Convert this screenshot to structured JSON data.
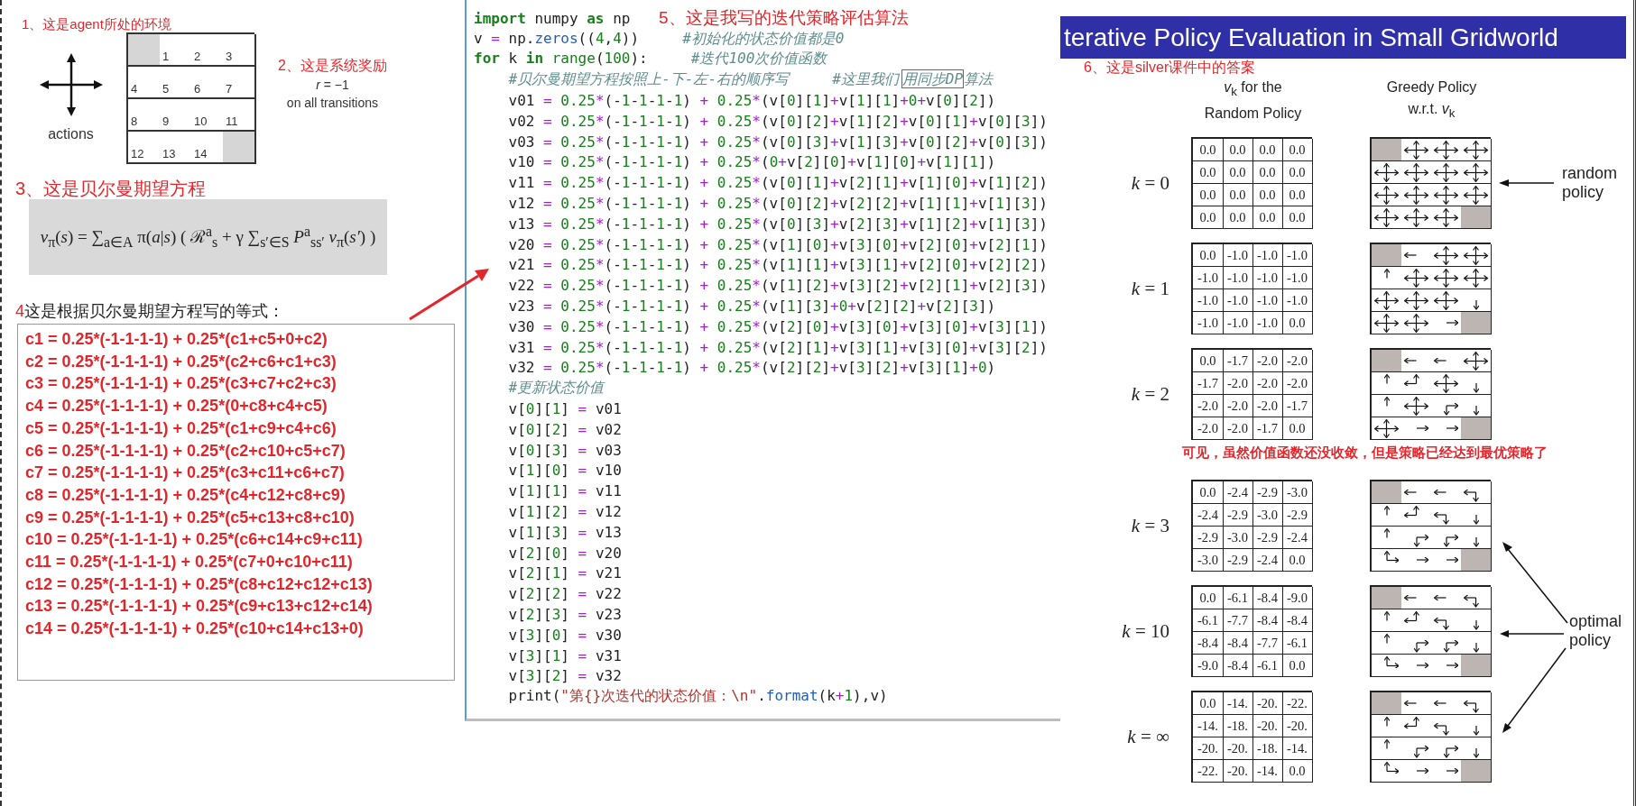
{
  "left": {
    "environment": {
      "caption": "1、这是agent所处的环境",
      "actions_label": "actions",
      "cells": [
        {
          "terminal": true
        },
        {
          "terminal": false,
          "label": "1"
        },
        {
          "terminal": false,
          "label": "2"
        },
        {
          "terminal": false,
          "label": "3"
        },
        {
          "terminal": false,
          "label": "4"
        },
        {
          "terminal": false,
          "label": "5"
        },
        {
          "terminal": false,
          "label": "6"
        },
        {
          "terminal": false,
          "label": "7"
        },
        {
          "terminal": false,
          "label": "8"
        },
        {
          "terminal": false,
          "label": "9"
        },
        {
          "terminal": false,
          "label": "10"
        },
        {
          "terminal": false,
          "label": "11"
        },
        {
          "terminal": false,
          "label": "12"
        },
        {
          "terminal": false,
          "label": "13"
        },
        {
          "terminal": false,
          "label": "14"
        },
        {
          "terminal": true
        }
      ]
    },
    "reward": {
      "caption": "2、这是系统奖励",
      "formula": "*r* = −1",
      "note": "on all transitions"
    },
    "bellman": {
      "caption": "3、这是贝尔曼期望方程",
      "formula": "*v*$_{π}$(*s*) = ∑$_{a∈A}$ π(*a*|*s*) ( ℛ$^{a}$$_{s}$ + γ ∑$_{s′∈S}$ *P*$^{a}$$_{ss′}$ *v*$_{π}$(*s′*) )"
    },
    "equations": {
      "number": "4",
      "caption": "这是根据贝尔曼期望方程写的等式：",
      "lines": [
        "c1 = 0.25*(-1-1-1-1) + 0.25*(c1+c5+0+c2)",
        "c2 = 0.25*(-1-1-1-1) + 0.25*(c2+c6+c1+c3)",
        "c3 = 0.25*(-1-1-1-1) + 0.25*(c3+c7+c2+c3)",
        "c4 = 0.25*(-1-1-1-1) + 0.25*(0+c8+c4+c5)",
        "c5 = 0.25*(-1-1-1-1) + 0.25*(c1+c9+c4+c6)",
        "c6 = 0.25*(-1-1-1-1) + 0.25*(c2+c10+c5+c7)",
        "c7 = 0.25*(-1-1-1-1) + 0.25*(c3+c11+c6+c7)",
        "c8 = 0.25*(-1-1-1-1) + 0.25*(c4+c12+c8+c9)",
        "c9 = 0.25*(-1-1-1-1) + 0.25*(c5+c13+c8+c10)",
        "c10 = 0.25*(-1-1-1-1) + 0.25*(c6+c14+c9+c11)",
        "c11 = 0.25*(-1-1-1-1) + 0.25*(c7+0+c10+c11)",
        "c12 = 0.25*(-1-1-1-1) + 0.25*(c8+c12+c12+c13)",
        "c13 = 0.25*(-1-1-1-1) + 0.25*(c9+c13+c12+c14)",
        "c14 = 0.25*(-1-1-1-1) + 0.25*(c10+c14+c13+0)"
      ]
    }
  },
  "code": {
    "lines": [
      {
        "indented": false,
        "note": "5、这是我写的迭代策略评估算法",
        "segments": [
          {
            "kind": "keyword",
            "text": "import"
          },
          {
            "kind": "code",
            "text": " numpy "
          },
          {
            "kind": "keyword",
            "text": "as"
          },
          {
            "kind": "code",
            "text": " np"
          }
        ]
      },
      {
        "indented": false,
        "segments": [
          {
            "kind": "code",
            "text": "v = np."
          },
          {
            "kind": "function",
            "text": "zeros"
          },
          {
            "kind": "code",
            "text": "((4,4))"
          },
          {
            "kind": "comment",
            "text": "#初始化的状态价值都是0"
          }
        ]
      },
      {
        "indented": false,
        "segments": [
          {
            "kind": "keyword",
            "text": "for"
          },
          {
            "kind": "code",
            "text": " k "
          },
          {
            "kind": "keyword",
            "text": "in"
          },
          {
            "kind": "builtin",
            "text": " range"
          },
          {
            "kind": "code",
            "text": "(100):"
          },
          {
            "kind": "comment",
            "text": "#迭代100次价值函数"
          }
        ]
      },
      {
        "indented": true,
        "segments": [
          {
            "kind": "comment",
            "text": "#贝尔曼期望方程按照上-下-左-右的顺序写"
          },
          {
            "kind": "comment",
            "text": "#这里我们"
          },
          {
            "kind": "comment-boxed",
            "text": "用同步DP"
          },
          {
            "kind": "comment-cont",
            "text": "算法"
          }
        ]
      },
      {
        "indented": true,
        "segments": [
          {
            "kind": "code",
            "text": "v01 = 0.25*(-1-1-1-1) + 0.25*(v[0][1]+v[1][1]+0+v[0][2])"
          }
        ]
      },
      {
        "indented": true,
        "segments": [
          {
            "kind": "code",
            "text": "v02 = 0.25*(-1-1-1-1) + 0.25*(v[0][2]+v[1][2]+v[0][1]+v[0][3])"
          }
        ]
      },
      {
        "indented": true,
        "segments": [
          {
            "kind": "code",
            "text": "v03 = 0.25*(-1-1-1-1) + 0.25*(v[0][3]+v[1][3]+v[0][2]+v[0][3])"
          }
        ]
      },
      {
        "indented": true,
        "segments": [
          {
            "kind": "code",
            "text": "v10 = 0.25*(-1-1-1-1) + 0.25*(0+v[2][0]+v[1][0]+v[1][1])"
          }
        ]
      },
      {
        "indented": true,
        "segments": [
          {
            "kind": "code",
            "text": "v11 = 0.25*(-1-1-1-1) + 0.25*(v[0][1]+v[2][1]+v[1][0]+v[1][2])"
          }
        ]
      },
      {
        "indented": true,
        "segments": [
          {
            "kind": "code",
            "text": "v12 = 0.25*(-1-1-1-1) + 0.25*(v[0][2]+v[2][2]+v[1][1]+v[1][3])"
          }
        ]
      },
      {
        "indented": true,
        "segments": [
          {
            "kind": "code",
            "text": "v13 = 0.25*(-1-1-1-1) + 0.25*(v[0][3]+v[2][3]+v[1][2]+v[1][3])"
          }
        ]
      },
      {
        "indented": true,
        "segments": [
          {
            "kind": "code",
            "text": "v20 = 0.25*(-1-1-1-1) + 0.25*(v[1][0]+v[3][0]+v[2][0]+v[2][1])"
          }
        ]
      },
      {
        "indented": true,
        "segments": [
          {
            "kind": "code",
            "text": "v21 = 0.25*(-1-1-1-1) + 0.25*(v[1][1]+v[3][1]+v[2][0]+v[2][2])"
          }
        ]
      },
      {
        "indented": true,
        "segments": [
          {
            "kind": "code",
            "text": "v22 = 0.25*(-1-1-1-1) + 0.25*(v[1][2]+v[3][2]+v[2][1]+v[2][3])"
          }
        ]
      },
      {
        "indented": true,
        "segments": [
          {
            "kind": "code",
            "text": "v23 = 0.25*(-1-1-1-1) + 0.25*(v[1][3]+0+v[2][2]+v[2][3])"
          }
        ]
      },
      {
        "indented": true,
        "segments": [
          {
            "kind": "code",
            "text": "v30 = 0.25*(-1-1-1-1) + 0.25*(v[2][0]+v[3][0]+v[3][0]+v[3][1])"
          }
        ]
      },
      {
        "indented": true,
        "segments": [
          {
            "kind": "code",
            "text": "v31 = 0.25*(-1-1-1-1) + 0.25*(v[2][1]+v[3][1]+v[3][0]+v[3][2])"
          }
        ]
      },
      {
        "indented": true,
        "segments": [
          {
            "kind": "code",
            "text": "v32 = 0.25*(-1-1-1-1) + 0.25*(v[2][2]+v[3][2]+v[3][1]+0)"
          }
        ]
      },
      {
        "indented": true,
        "segments": [
          {
            "kind": "comment",
            "text": "#更新状态价值"
          }
        ]
      },
      {
        "indented": true,
        "segments": [
          {
            "kind": "code",
            "text": "v[0][1] = v01"
          }
        ]
      },
      {
        "indented": true,
        "segments": [
          {
            "kind": "code",
            "text": "v[0][2] = v02"
          }
        ]
      },
      {
        "indented": true,
        "segments": [
          {
            "kind": "code",
            "text": "v[0][3] = v03"
          }
        ]
      },
      {
        "indented": true,
        "segments": [
          {
            "kind": "code",
            "text": "v[1][0] = v10"
          }
        ]
      },
      {
        "indented": true,
        "segments": [
          {
            "kind": "code",
            "text": "v[1][1] = v11"
          }
        ]
      },
      {
        "indented": true,
        "segments": [
          {
            "kind": "code",
            "text": "v[1][2] = v12"
          }
        ]
      },
      {
        "indented": true,
        "segments": [
          {
            "kind": "code",
            "text": "v[1][3] = v13"
          }
        ]
      },
      {
        "indented": true,
        "segments": [
          {
            "kind": "code",
            "text": "v[2][0] = v20"
          }
        ]
      },
      {
        "indented": true,
        "segments": [
          {
            "kind": "code",
            "text": "v[2][1] = v21"
          }
        ]
      },
      {
        "indented": true,
        "segments": [
          {
            "kind": "code",
            "text": "v[2][2] = v22"
          }
        ]
      },
      {
        "indented": true,
        "segments": [
          {
            "kind": "code",
            "text": "v[2][3] = v23"
          }
        ]
      },
      {
        "indented": true,
        "segments": [
          {
            "kind": "code",
            "text": "v[3][0] = v30"
          }
        ]
      },
      {
        "indented": true,
        "segments": [
          {
            "kind": "code",
            "text": "v[3][1] = v31"
          }
        ]
      },
      {
        "indented": true,
        "segments": [
          {
            "kind": "code",
            "text": "v[3][2] = v32"
          }
        ]
      },
      {
        "indented": true,
        "segments": [
          {
            "kind": "code",
            "text": "print("
          },
          {
            "kind": "string",
            "text": "\"第{}次迭代的状态价值：\\n\""
          },
          {
            "kind": "code",
            "text": "."
          },
          {
            "kind": "function",
            "text": "format"
          },
          {
            "kind": "code",
            "text": "(k+1),v)"
          }
        ]
      }
    ]
  },
  "slide": {
    "title": "terative Policy Evaluation in Small Gridworld",
    "note": "6、这是silver课件中的答案",
    "value_heading": [
      "*v*$_{k}$ for the",
      "Random Policy"
    ],
    "policy_heading": [
      "Greedy Policy",
      "w.r.t. *v*$_{k}$"
    ],
    "random_label": "random policy",
    "optimal_label": "optimal policy",
    "rows": [
      {
        "label": "*k* = 0",
        "values": [
          "0.0",
          "0.0",
          "0.0",
          "0.0",
          "0.0",
          "0.0",
          "0.0",
          "0.0",
          "0.0",
          "0.0",
          "0.0",
          "0.0",
          "0.0",
          "0.0",
          "0.0",
          "0.0"
        ],
        "policy": [
          {
            "kind": "terminal"
          },
          {
            "kind": "all"
          },
          {
            "kind": "all"
          },
          {
            "kind": "all"
          },
          {
            "kind": "all"
          },
          {
            "kind": "all"
          },
          {
            "kind": "all"
          },
          {
            "kind": "all"
          },
          {
            "kind": "all"
          },
          {
            "kind": "all"
          },
          {
            "kind": "all"
          },
          {
            "kind": "all"
          },
          {
            "kind": "all"
          },
          {
            "kind": "all"
          },
          {
            "kind": "all"
          },
          {
            "kind": "terminal"
          }
        ]
      },
      {
        "label": "*k* = 1",
        "values": [
          "0.0",
          "-1.0",
          "-1.0",
          "-1.0",
          "-1.0",
          "-1.0",
          "-1.0",
          "-1.0",
          "-1.0",
          "-1.0",
          "-1.0",
          "-1.0",
          "-1.0",
          "-1.0",
          "-1.0",
          "0.0"
        ],
        "policy": [
          {
            "kind": "terminal"
          },
          {
            "kind": "left"
          },
          {
            "kind": "all"
          },
          {
            "kind": "all"
          },
          {
            "kind": "up"
          },
          {
            "kind": "all"
          },
          {
            "kind": "all"
          },
          {
            "kind": "all"
          },
          {
            "kind": "all"
          },
          {
            "kind": "all"
          },
          {
            "kind": "all"
          },
          {
            "kind": "down"
          },
          {
            "kind": "all"
          },
          {
            "kind": "all"
          },
          {
            "kind": "right"
          },
          {
            "kind": "terminal"
          }
        ]
      },
      {
        "label": "*k* = 2",
        "values": [
          "0.0",
          "-1.7",
          "-2.0",
          "-2.0",
          "-1.7",
          "-2.0",
          "-2.0",
          "-2.0",
          "-2.0",
          "-2.0",
          "-2.0",
          "-1.7",
          "-2.0",
          "-2.0",
          "-1.7",
          "0.0"
        ],
        "policy": [
          {
            "kind": "terminal"
          },
          {
            "kind": "left"
          },
          {
            "kind": "left"
          },
          {
            "kind": "all"
          },
          {
            "kind": "up"
          },
          {
            "kind": "up-left"
          },
          {
            "kind": "all"
          },
          {
            "kind": "down"
          },
          {
            "kind": "up"
          },
          {
            "kind": "all"
          },
          {
            "kind": "down-right"
          },
          {
            "kind": "down"
          },
          {
            "kind": "all"
          },
          {
            "kind": "right"
          },
          {
            "kind": "right"
          },
          {
            "kind": "terminal"
          }
        ],
        "remark": "可见，虽然价值函数还没收敛，但是策略已经达到最优策略了"
      },
      {
        "label": "*k* = 3",
        "values": [
          "0.0",
          "-2.4",
          "-2.9",
          "-3.0",
          "-2.4",
          "-2.9",
          "-3.0",
          "-2.9",
          "-2.9",
          "-3.0",
          "-2.9",
          "-2.4",
          "-3.0",
          "-2.9",
          "-2.4",
          "0.0"
        ],
        "policy": [
          {
            "kind": "terminal"
          },
          {
            "kind": "left"
          },
          {
            "kind": "left"
          },
          {
            "kind": "left-down"
          },
          {
            "kind": "up"
          },
          {
            "kind": "up-left"
          },
          {
            "kind": "left-down"
          },
          {
            "kind": "down"
          },
          {
            "kind": "up"
          },
          {
            "kind": "down-right"
          },
          {
            "kind": "down-right"
          },
          {
            "kind": "down"
          },
          {
            "kind": "up-right"
          },
          {
            "kind": "right"
          },
          {
            "kind": "right"
          },
          {
            "kind": "terminal"
          }
        ]
      },
      {
        "label": "*k* = 10",
        "values": [
          "0.0",
          "-6.1",
          "-8.4",
          "-9.0",
          "-6.1",
          "-7.7",
          "-8.4",
          "-8.4",
          "-8.4",
          "-8.4",
          "-7.7",
          "-6.1",
          "-9.0",
          "-8.4",
          "-6.1",
          "0.0"
        ],
        "policy": [
          {
            "kind": "terminal"
          },
          {
            "kind": "left"
          },
          {
            "kind": "left"
          },
          {
            "kind": "left-down"
          },
          {
            "kind": "up"
          },
          {
            "kind": "up-left"
          },
          {
            "kind": "left-down"
          },
          {
            "kind": "down"
          },
          {
            "kind": "up"
          },
          {
            "kind": "down-right"
          },
          {
            "kind": "down-right"
          },
          {
            "kind": "down"
          },
          {
            "kind": "up-right"
          },
          {
            "kind": "right"
          },
          {
            "kind": "right"
          },
          {
            "kind": "terminal"
          }
        ]
      },
      {
        "label": "*k* = ∞",
        "values": [
          "0.0",
          "-14.",
          "-20.",
          "-22.",
          "-14.",
          "-18.",
          "-20.",
          "-20.",
          "-20.",
          "-20.",
          "-18.",
          "-14.",
          "-22.",
          "-20.",
          "-14.",
          "0.0"
        ],
        "policy": [
          {
            "kind": "terminal"
          },
          {
            "kind": "left"
          },
          {
            "kind": "left"
          },
          {
            "kind": "left-down"
          },
          {
            "kind": "up"
          },
          {
            "kind": "up-left"
          },
          {
            "kind": "left-down"
          },
          {
            "kind": "down"
          },
          {
            "kind": "up"
          },
          {
            "kind": "down-right"
          },
          {
            "kind": "down-right"
          },
          {
            "kind": "down"
          },
          {
            "kind": "up-right"
          },
          {
            "kind": "right"
          },
          {
            "kind": "right"
          },
          {
            "kind": "terminal"
          }
        ]
      }
    ]
  }
}
